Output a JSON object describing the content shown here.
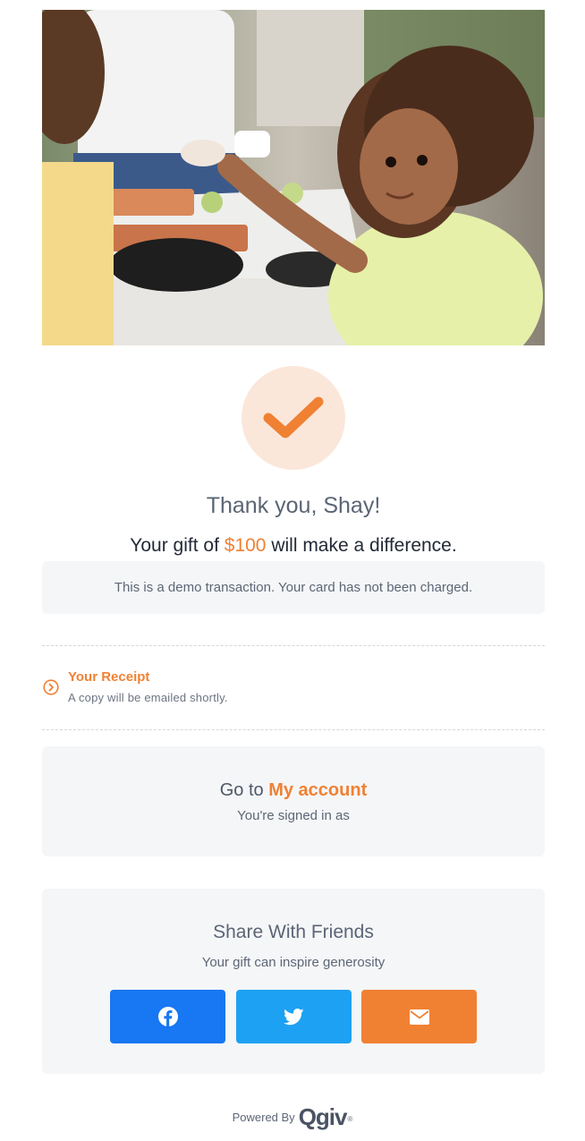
{
  "hero": {
    "icon": "hero-photo"
  },
  "confirmation": {
    "icon": "checkmark-icon",
    "thanks": "Thank you, Shay!",
    "gift_prefix": "Your gift of ",
    "amount": "$100",
    "gift_suffix": " will make a difference.",
    "demo_notice": "This is a demo transaction. Your card has not been charged."
  },
  "receipt": {
    "icon": "chevron-right-circle-icon",
    "title": "Your Receipt",
    "subtitle": "A copy will be emailed shortly."
  },
  "account": {
    "prefix": "Go to ",
    "link": "My account",
    "subtitle": "You're signed in as"
  },
  "share": {
    "title": "Share With Friends",
    "subtitle": "Your gift can inspire generosity",
    "buttons": [
      {
        "icon": "facebook-icon",
        "color": "#1877f2"
      },
      {
        "icon": "twitter-icon",
        "color": "#1da1f2"
      },
      {
        "icon": "email-icon",
        "color": "#f08133"
      }
    ]
  },
  "footer": {
    "powered_by": "Powered By",
    "logo": "Qgiv",
    "registered": "®"
  },
  "colors": {
    "accent": "#f08133",
    "panel": "#f5f6f8",
    "accent_soft": "#fbe7da"
  }
}
